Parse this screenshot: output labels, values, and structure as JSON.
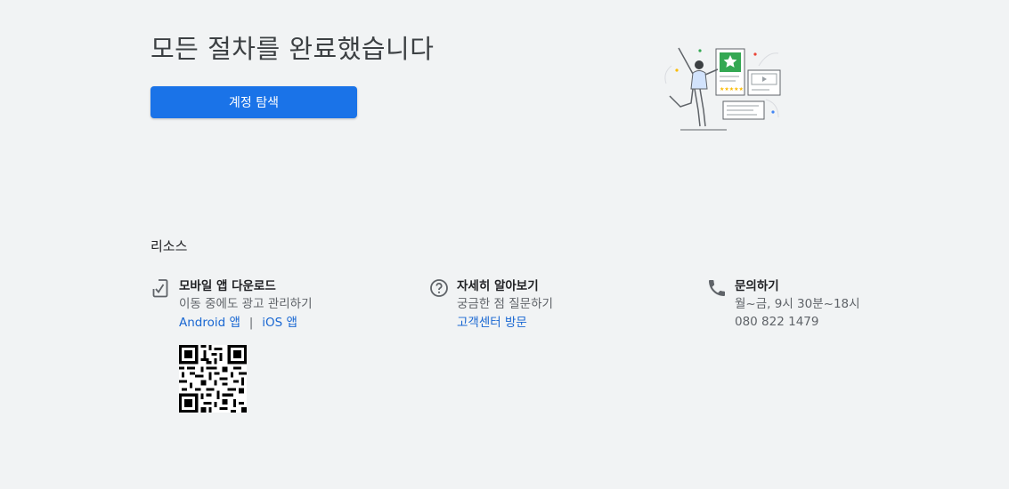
{
  "header": {
    "title": "모든 절차를 완료했습니다",
    "cta_label": "계정 탐색"
  },
  "resources": {
    "heading": "리소스",
    "mobile": {
      "title": "모바일 앱 다운로드",
      "description": "이동 중에도 광고 관리하기",
      "android_label": "Android 앱",
      "separator": "|",
      "ios_label": "iOS 앱",
      "icon": "phone-download-icon"
    },
    "help": {
      "title": "자세히 알아보기",
      "description": "궁금한 점 질문하기",
      "link_label": "고객센터 방문",
      "icon": "help-circle-icon"
    },
    "contact": {
      "title": "문의하기",
      "hours": "월~금, 9시 30분~18시",
      "phone": "080 822 1479",
      "icon": "phone-icon"
    }
  },
  "colors": {
    "background": "#f1f3f4",
    "primary": "#1a73e8",
    "link": "#1967d2",
    "text": "#3c4043"
  }
}
